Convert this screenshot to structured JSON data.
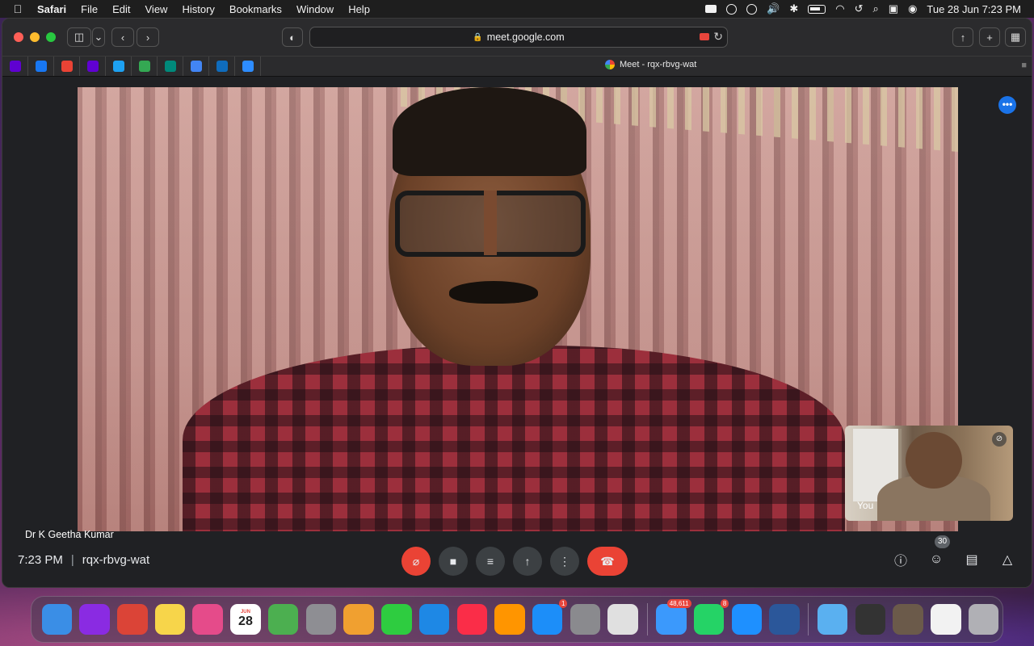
{
  "menubar": {
    "app_name": "Safari",
    "items": [
      "File",
      "Edit",
      "View",
      "History",
      "Bookmarks",
      "Window",
      "Help"
    ],
    "clock": "Tue 28 Jun  7:23 PM"
  },
  "browser": {
    "url": "meet.google.com",
    "tab_title": "Meet - rqx-rbvg-wat",
    "favorites": [
      {
        "icon": "yahoo-icon",
        "color": "#5f01d1"
      },
      {
        "icon": "facebook-icon",
        "color": "#1877f2"
      },
      {
        "icon": "gmail-icon",
        "color": "#ea4335"
      },
      {
        "icon": "yahoo-mail-icon",
        "color": "#6001d2"
      },
      {
        "icon": "twitter-icon",
        "color": "#1da1f2"
      },
      {
        "icon": "google-calendar-icon",
        "color": "#34a853"
      },
      {
        "icon": "google-meet-icon",
        "color": "#00897b"
      },
      {
        "icon": "help-icon",
        "color": "#4285f4"
      },
      {
        "icon": "chart-app-icon",
        "color": "#0f6cbd"
      },
      {
        "icon": "zoom-icon",
        "color": "#2d8cff"
      }
    ]
  },
  "meet": {
    "main_participant": "Dr K Geetha Kumar",
    "self_label": "You",
    "time": "7:23 PM",
    "separator": "|",
    "meeting_code": "rqx-rbvg-wat",
    "participant_count": "30",
    "more_button": "•••"
  },
  "dock": {
    "apps": [
      {
        "name": "finder-icon",
        "color": "#3a8ee6"
      },
      {
        "name": "siri-icon",
        "color": "#8a2be2"
      },
      {
        "name": "chrome-icon",
        "color": "#db4437"
      },
      {
        "name": "notes-icon",
        "color": "#f7d54a"
      },
      {
        "name": "photos-booth-icon",
        "color": "#e54b8a"
      },
      {
        "name": "calendar-icon",
        "color": "#ffffff",
        "month": "JUN",
        "day": "28"
      },
      {
        "name": "maps-icon",
        "color": "#4caf50"
      },
      {
        "name": "launchpad-icon",
        "color": "#8e8e93"
      },
      {
        "name": "photos-icon",
        "color": "#f0a030"
      },
      {
        "name": "facetime-icon",
        "color": "#2ecc40"
      },
      {
        "name": "keynote-icon",
        "color": "#1e88e5"
      },
      {
        "name": "music-icon",
        "color": "#fa2d48"
      },
      {
        "name": "books-icon",
        "color": "#ff9500"
      },
      {
        "name": "app-store-icon",
        "color": "#1c8ef9",
        "badge": "1"
      },
      {
        "name": "system-preferences-icon",
        "color": "#8a8a8e"
      },
      {
        "name": "screenshot-icon",
        "color": "#e0e0e0"
      },
      {
        "name": "mail-icon",
        "color": "#3b99fc",
        "badge": "48,611"
      },
      {
        "name": "whatsapp-icon",
        "color": "#25d366",
        "badge": "8"
      },
      {
        "name": "safari-icon",
        "color": "#1e90ff"
      },
      {
        "name": "word-icon",
        "color": "#2b579a"
      },
      {
        "name": "downloads-folder-icon",
        "color": "#5ab0f0"
      },
      {
        "name": "window-thumbnail-icon",
        "color": "#333333"
      },
      {
        "name": "window-thumbnail-icon-2",
        "color": "#6b5a4a"
      },
      {
        "name": "window-thumbnail-icon-3",
        "color": "#f2f2f2"
      },
      {
        "name": "trash-icon",
        "color": "#b0b0b5"
      }
    ]
  }
}
